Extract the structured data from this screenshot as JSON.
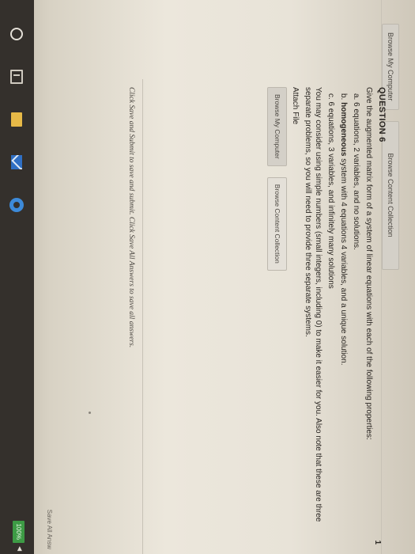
{
  "top_buttons": {
    "browse_my_computer": "Browse My Computer",
    "browse_content_collection": "Browse Content Collection"
  },
  "question": {
    "title": "QUESTION 6",
    "number": "1",
    "prompt": "Give the augmented matrix form of a system of linear equations with each of the following properties:",
    "part_a": "a. 6 equations, 2 variables, and no solutions.",
    "part_b_prefix": "b. ",
    "part_b_bold": "homogeneous",
    "part_b_rest": " system with 4 equations 4 variables, and a unique solution.",
    "part_c": "c. 6 equations, 3 variables, and infinitely many solutions",
    "note": "You may consider using simple numbers (small integers, including 0) to make it easier for you.  Also note that these are three separate problems, so you will need to provide three separate systems.",
    "attach_label": "Attach File",
    "attach_browse_my_computer": "Browse My Computer",
    "attach_browse_content_collection": "Browse Content Collection"
  },
  "footer_note": "Click Save and Submit to save and submit. Click Save All Answers to save all answers.",
  "save_all": "Save All Answ",
  "taskbar": {
    "battery": "100%",
    "icons": [
      "cortana-icon",
      "task-view-icon",
      "file-explorer-icon",
      "mail-icon",
      "edge-icon"
    ]
  }
}
